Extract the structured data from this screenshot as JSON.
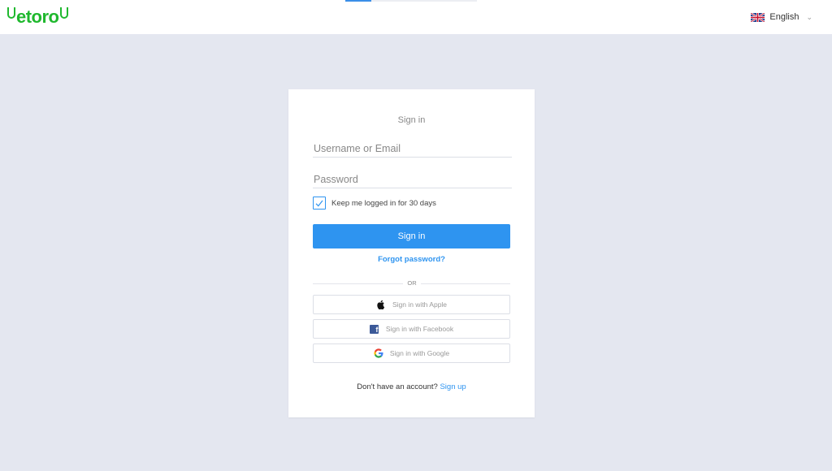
{
  "header": {
    "logo_text": "etoro",
    "language": "English",
    "progress_fraction": 0.2
  },
  "signin": {
    "title": "Sign in",
    "username_placeholder": "Username or Email",
    "password_placeholder": "Password",
    "remember_label": "Keep me logged in for 30 days",
    "remember_checked": true,
    "submit_label": "Sign in",
    "forgot_label": "Forgot password?",
    "divider_label": "OR",
    "social": {
      "apple_label": "Sign in with Apple",
      "facebook_label": "Sign in with Facebook",
      "google_label": "Sign in with Google"
    },
    "signup_prompt": "Don't have an account?",
    "signup_link": "Sign up"
  },
  "colors": {
    "brand_green": "#1fb82e",
    "accent_blue": "#2e94f0",
    "background": "#e4e7f0"
  }
}
